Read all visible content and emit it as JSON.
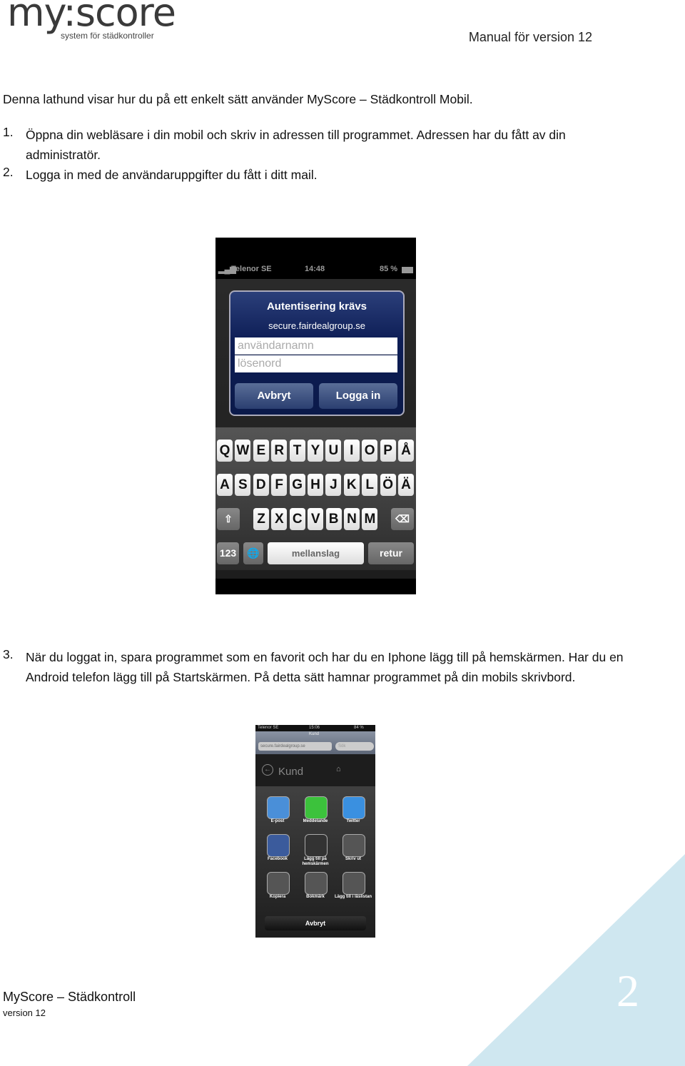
{
  "header": {
    "logo_text": "my:score",
    "logo_tagline": "system för städkontroller",
    "version_label": "Manual för version 12"
  },
  "intro": "Denna lathund visar hur du på ett enkelt sätt använder MyScore – Städkontroll Mobil.",
  "steps": [
    {
      "num": "1.",
      "text": "Öppna din webläsare i din mobil och skriv in adressen till programmet. Adressen har du fått av din administratör."
    },
    {
      "num": "2.",
      "text": "Logga in med de användaruppgifter du fått i ditt mail."
    },
    {
      "num": "3.",
      "text": "När du loggat in, spara programmet som en favorit och har du en Iphone lägg till på hemskärmen. Har du en Android telefon lägg till på Startskärmen. På detta sätt hamnar programmet på din mobils skrivbord."
    }
  ],
  "screenshot1": {
    "status": {
      "carrier": "Telenor SE",
      "time": "14:48",
      "battery": "85 %"
    },
    "dialog": {
      "title": "Autentisering krävs",
      "host": "secure.fairdealgroup.se",
      "username_placeholder": "användarnamn",
      "password_placeholder": "lösenord",
      "cancel": "Avbryt",
      "login": "Logga in"
    },
    "keyboard": {
      "row1": [
        "Q",
        "W",
        "E",
        "R",
        "T",
        "Y",
        "U",
        "I",
        "O",
        "P",
        "Å"
      ],
      "row2": [
        "A",
        "S",
        "D",
        "F",
        "G",
        "H",
        "J",
        "K",
        "L",
        "Ö",
        "Ä"
      ],
      "row3": [
        "Z",
        "X",
        "C",
        "V",
        "B",
        "N",
        "M"
      ],
      "shift": "⇧",
      "delete": "⌫",
      "numbers": "123",
      "globe": "🌐",
      "space": "mellanslag",
      "return": "retur"
    }
  },
  "screenshot2": {
    "status": {
      "carrier": "Telenor SE",
      "time": "15:06",
      "battery": "84 %"
    },
    "page_title": "Kund",
    "url": "secure.fairdealgroup.se",
    "search_placeholder": "Sök",
    "nav_title": "Kund",
    "share_items": [
      {
        "label": "E-post",
        "color": "#4a8fd8"
      },
      {
        "label": "Meddelande",
        "color": "#3cc23c"
      },
      {
        "label": "Twitter",
        "color": "#3a90e0"
      },
      {
        "label": "Facebook",
        "color": "#3b5b9c"
      },
      {
        "label": "Lägg till på hemskärmen",
        "color": "#333"
      },
      {
        "label": "Skriv ut",
        "color": "#555"
      },
      {
        "label": "Kopiera",
        "color": "#555"
      },
      {
        "label": "Bokmärk",
        "color": "#555"
      },
      {
        "label": "Lägg till i läslistan",
        "color": "#555"
      }
    ],
    "cancel": "Avbryt"
  },
  "footer": {
    "title": "MyScore – Städkontroll",
    "version": "version 12",
    "page_number": "2"
  },
  "colors": {
    "accent_triangle": "#cfe7f0",
    "dialog_blue": "#0d1d55"
  }
}
